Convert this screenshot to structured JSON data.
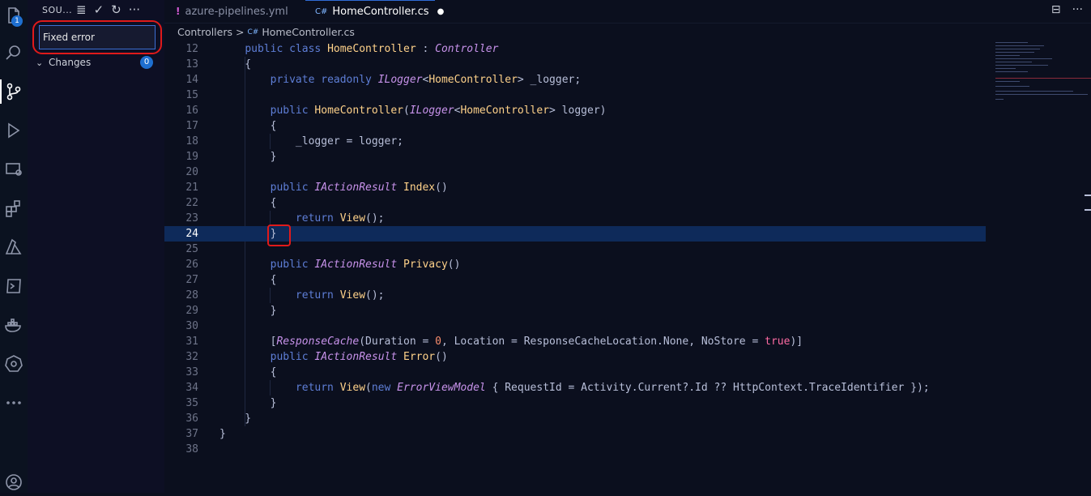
{
  "activity_bar": {
    "items": [
      {
        "name": "explorer",
        "badge": "1"
      },
      {
        "name": "search"
      },
      {
        "name": "source-control"
      },
      {
        "name": "run-debug"
      },
      {
        "name": "remote-explorer"
      },
      {
        "name": "extensions"
      },
      {
        "name": "azure"
      },
      {
        "name": "terminal"
      },
      {
        "name": "docker"
      },
      {
        "name": "kubernetes"
      },
      {
        "name": "more"
      },
      {
        "name": "accounts"
      }
    ]
  },
  "sidebar": {
    "title": "SOU...",
    "actions": [
      "≣",
      "✓",
      "↻",
      "···"
    ],
    "commit_message": "Fixed error",
    "changes_label": "Changes",
    "changes_count": "0"
  },
  "tabs": [
    {
      "icon": "!",
      "label": "azure-pipelines.yml",
      "active": false
    },
    {
      "icon": "C#",
      "label": "HomeController.cs",
      "active": true,
      "dirty_marker": "●"
    }
  ],
  "tab_actions": [
    "⊟",
    "···"
  ],
  "breadcrumb": {
    "folder": "Controllers",
    "separator": ">",
    "file_icon": "C#",
    "file": "HomeController.cs"
  },
  "editor": {
    "current_line": 24,
    "lines": [
      {
        "n": "12",
        "text": "    public class HomeController : Controller"
      },
      {
        "n": "13",
        "text": "    {"
      },
      {
        "n": "14",
        "text": "        private readonly ILogger<HomeController> _logger;"
      },
      {
        "n": "15",
        "text": ""
      },
      {
        "n": "16",
        "text": "        public HomeController(ILogger<HomeController> logger)"
      },
      {
        "n": "17",
        "text": "        {"
      },
      {
        "n": "18",
        "text": "            _logger = logger;"
      },
      {
        "n": "19",
        "text": "        }"
      },
      {
        "n": "20",
        "text": ""
      },
      {
        "n": "21",
        "text": "        public IActionResult Index()"
      },
      {
        "n": "22",
        "text": "        {"
      },
      {
        "n": "23",
        "text": "            return View();"
      },
      {
        "n": "24",
        "text": "        }"
      },
      {
        "n": "25",
        "text": ""
      },
      {
        "n": "26",
        "text": "        public IActionResult Privacy()"
      },
      {
        "n": "27",
        "text": "        {"
      },
      {
        "n": "28",
        "text": "            return View();"
      },
      {
        "n": "29",
        "text": "        }"
      },
      {
        "n": "30",
        "text": ""
      },
      {
        "n": "31",
        "text": "        [ResponseCache(Duration = 0, Location = ResponseCacheLocation.None, NoStore = true)]"
      },
      {
        "n": "32",
        "text": "        public IActionResult Error()"
      },
      {
        "n": "33",
        "text": "        {"
      },
      {
        "n": "34",
        "text": "            return View(new ErrorViewModel { RequestId = Activity.Current?.Id ?? HttpContext.TraceIdentifier });"
      },
      {
        "n": "35",
        "text": "        }"
      },
      {
        "n": "36",
        "text": "    }"
      },
      {
        "n": "37",
        "text": "}"
      },
      {
        "n": "38",
        "text": ""
      }
    ]
  }
}
